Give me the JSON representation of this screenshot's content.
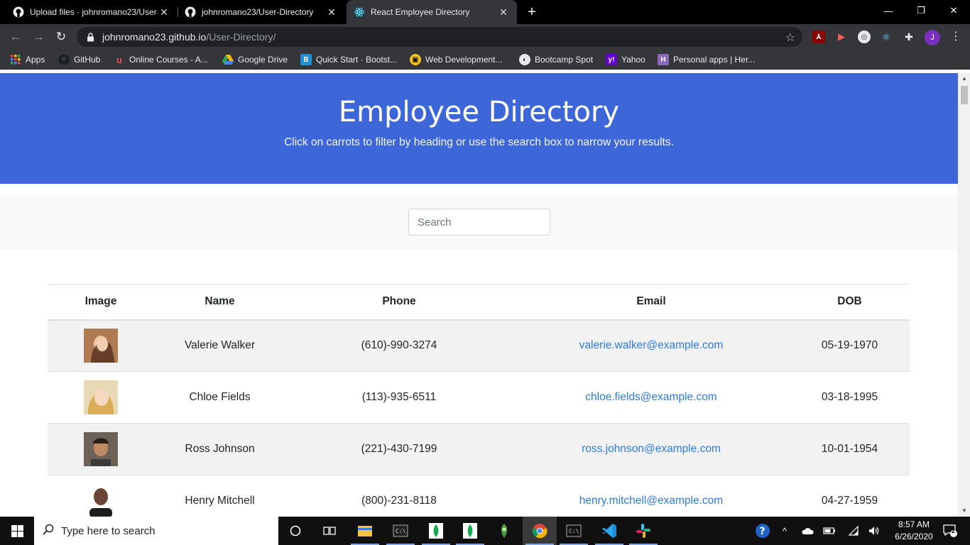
{
  "browser": {
    "tabs": [
      {
        "title": "Upload files · johnromano23/User-Directory",
        "icon": "github-icon",
        "active": false
      },
      {
        "title": "johnromano23/User-Directory",
        "icon": "github-icon",
        "active": false
      },
      {
        "title": "React Employee Directory",
        "icon": "react-icon",
        "active": true
      }
    ],
    "url_host": "johnromano23.github.io",
    "url_path": "/User-Directory/",
    "bookmarks": [
      {
        "label": "Apps",
        "icon": "apps-grid-icon"
      },
      {
        "label": "GitHub",
        "icon": "github-icon"
      },
      {
        "label": "Online Courses - A...",
        "icon": "udemy-icon"
      },
      {
        "label": "Google Drive",
        "icon": "google-drive-icon"
      },
      {
        "label": "Quick Start · Bootst...",
        "icon": "bootstrap-icon"
      },
      {
        "label": "Web Development...",
        "icon": "web-dev-icon"
      },
      {
        "label": "Bootcamp Spot",
        "icon": "bootcamp-spot-icon"
      },
      {
        "label": "Yahoo",
        "icon": "yahoo-icon"
      },
      {
        "label": "Personal apps | Her...",
        "icon": "heroku-icon"
      }
    ],
    "profile_initial": "J"
  },
  "page": {
    "title": "Employee Directory",
    "subtitle": "Click on carrots to filter by heading or use the search box to narrow your results.",
    "search_placeholder": "Search",
    "columns": [
      "Image",
      "Name",
      "Phone",
      "Email",
      "DOB"
    ],
    "employees": [
      {
        "name": "Valerie Walker",
        "phone": "(610)-990-3274",
        "email": "valerie.walker@example.com",
        "dob": "05-19-1970",
        "avatar_color": "#7a4a2e"
      },
      {
        "name": "Chloe Fields",
        "phone": "(113)-935-6511",
        "email": "chloe.fields@example.com",
        "dob": "03-18-1995",
        "avatar_color": "#d9b26a"
      },
      {
        "name": "Ross Johnson",
        "phone": "(221)-430-7199",
        "email": "ross.johnson@example.com",
        "dob": "10-01-1954",
        "avatar_color": "#8a6a55"
      },
      {
        "name": "Henry Mitchell",
        "phone": "(800)-231-8118",
        "email": "henry.mitchell@example.com",
        "dob": "04-27-1959",
        "avatar_color": "#3b2a22"
      }
    ]
  },
  "taskbar": {
    "search_placeholder": "Type here to search",
    "time": "8:57 AM",
    "date": "6/26/2020",
    "notification_count": "2"
  }
}
